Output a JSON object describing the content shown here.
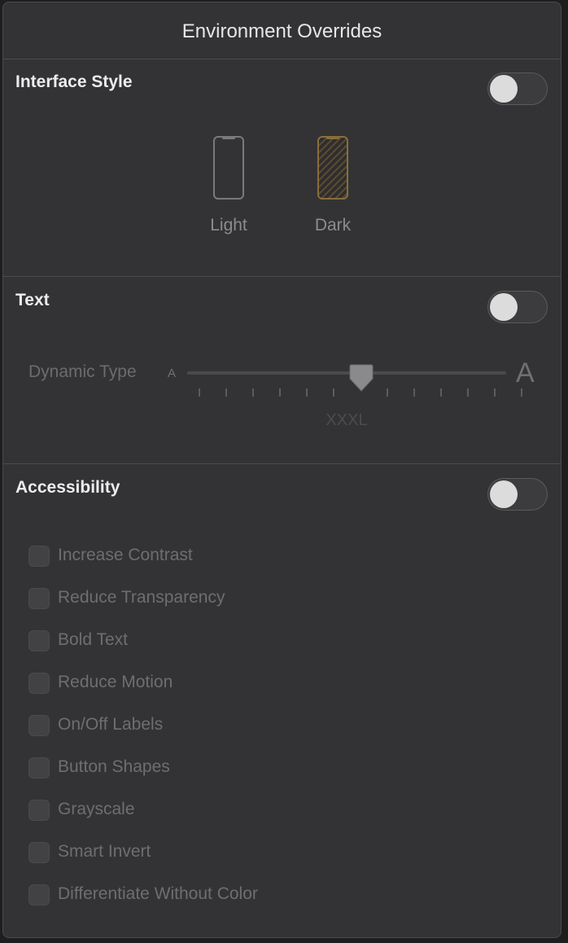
{
  "window": {
    "title": "Environment Overrides"
  },
  "interface_style": {
    "title": "Interface Style",
    "enabled": false,
    "options": [
      {
        "label": "Light",
        "selected": false,
        "icon": "iphone-outline-icon"
      },
      {
        "label": "Dark",
        "selected": true,
        "icon": "iphone-dark-hatched-icon"
      }
    ]
  },
  "text": {
    "title": "Text",
    "enabled": false,
    "dynamic_type": {
      "label": "Dynamic Type",
      "small_glyph": "A",
      "large_glyph": "A",
      "value_label": "XXXL",
      "step_index": 6,
      "step_count": 12
    }
  },
  "accessibility": {
    "title": "Accessibility",
    "enabled": false,
    "options": [
      {
        "label": "Increase Contrast",
        "checked": false
      },
      {
        "label": "Reduce Transparency",
        "checked": false
      },
      {
        "label": "Bold Text",
        "checked": false
      },
      {
        "label": "Reduce Motion",
        "checked": false
      },
      {
        "label": "On/Off Labels",
        "checked": false
      },
      {
        "label": "Button Shapes",
        "checked": false
      },
      {
        "label": "Grayscale",
        "checked": false
      },
      {
        "label": "Smart Invert",
        "checked": false
      },
      {
        "label": "Differentiate Without Color",
        "checked": false
      }
    ]
  },
  "colors": {
    "background": "#333335",
    "dark_accent": "#8a6d3a"
  }
}
